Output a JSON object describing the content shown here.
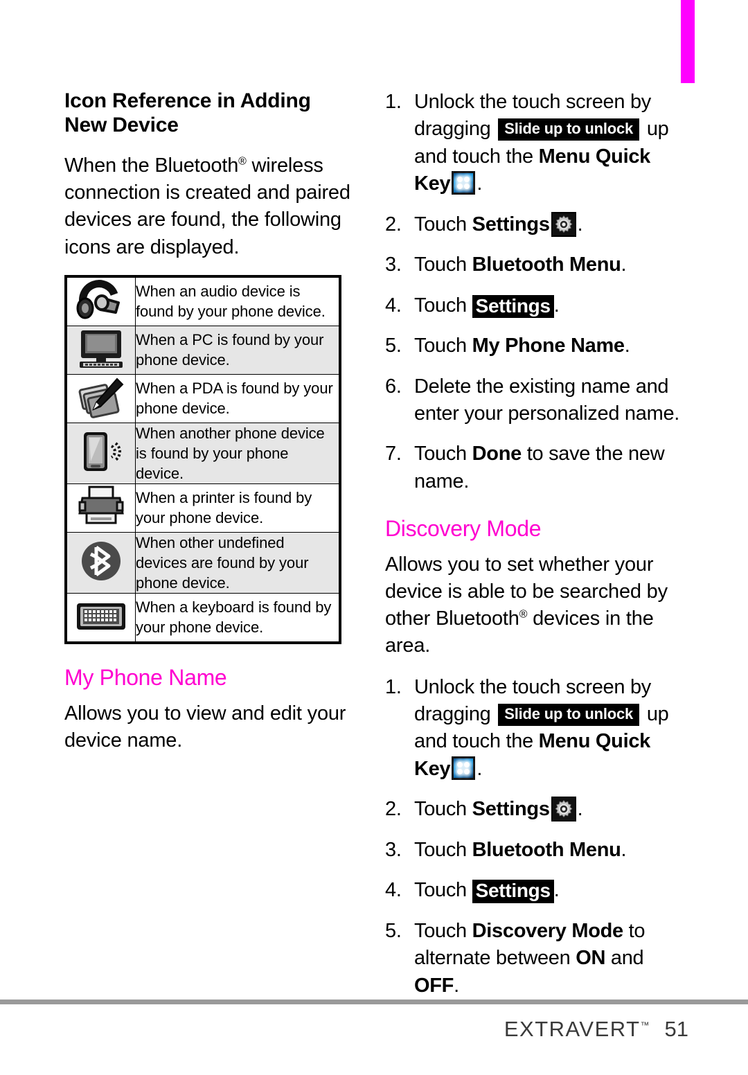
{
  "page": {
    "number": "51",
    "brand": "EXTRAVERT",
    "brand_tm": "™",
    "accent_color": "#ff00d0",
    "tab_color": "#ff00ff"
  },
  "left_column": {
    "heading": "Icon Reference in Adding New Device",
    "intro_before_reg": "When the Bluetooth",
    "intro_reg": "®",
    "intro_after_reg": " wireless connection is created and paired devices are found, the following icons are displayed.",
    "icon_table": {
      "rows": [
        {
          "icon": "audio-headset-icon",
          "shaded": false,
          "text": "When an audio device is found by your phone device."
        },
        {
          "icon": "pc-monitor-icon",
          "shaded": true,
          "text": "When a PC is found by your phone device."
        },
        {
          "icon": "pda-stylus-icon",
          "shaded": false,
          "text": "When a PDA is found by your phone device."
        },
        {
          "icon": "mobile-phone-icon",
          "shaded": true,
          "text": "When another phone device is found by your phone device."
        },
        {
          "icon": "printer-icon",
          "shaded": false,
          "text": "When a printer is found by your phone device."
        },
        {
          "icon": "bluetooth-icon",
          "shaded": true,
          "text": "When other undefined devices are found by your phone device."
        },
        {
          "icon": "keyboard-icon",
          "shaded": false,
          "text": "When a keyboard is found by your phone device."
        }
      ]
    },
    "my_phone_name": {
      "heading": "My Phone Name",
      "body": "Allows you to view and edit your device name."
    }
  },
  "right_column": {
    "my_phone_name_steps": [
      {
        "num": "1.",
        "parts": [
          {
            "t": "text",
            "v": "Unlock the touch screen by dragging "
          },
          {
            "t": "pill",
            "v": "Slide up to unlock"
          },
          {
            "t": "text",
            "v": " up and touch the "
          },
          {
            "t": "bold",
            "v": "Menu Quick Key"
          },
          {
            "t": "icon",
            "v": "menu-quick-key-icon"
          },
          {
            "t": "text",
            "v": "."
          }
        ]
      },
      {
        "num": "2.",
        "parts": [
          {
            "t": "text",
            "v": "Touch "
          },
          {
            "t": "bold",
            "v": "Settings"
          },
          {
            "t": "icon",
            "v": "settings-gear-icon"
          },
          {
            "t": "text",
            "v": "."
          }
        ]
      },
      {
        "num": "3.",
        "parts": [
          {
            "t": "text",
            "v": "Touch "
          },
          {
            "t": "bold",
            "v": "Bluetooth Menu"
          },
          {
            "t": "text",
            "v": "."
          }
        ]
      },
      {
        "num": "4.",
        "parts": [
          {
            "t": "text",
            "v": "Touch "
          },
          {
            "t": "invpill",
            "v": "Settings"
          },
          {
            "t": "text",
            "v": "."
          }
        ]
      },
      {
        "num": "5.",
        "parts": [
          {
            "t": "text",
            "v": "Touch "
          },
          {
            "t": "bold",
            "v": "My Phone Name"
          },
          {
            "t": "text",
            "v": "."
          }
        ]
      },
      {
        "num": "6.",
        "parts": [
          {
            "t": "text",
            "v": "Delete the existing name and enter your personalized name."
          }
        ]
      },
      {
        "num": "7.",
        "parts": [
          {
            "t": "text",
            "v": "Touch "
          },
          {
            "t": "bold",
            "v": "Done"
          },
          {
            "t": "text",
            "v": " to save the new name."
          }
        ]
      }
    ],
    "discovery_mode": {
      "heading": "Discovery Mode",
      "body_before_reg": "Allows you to set whether your device is able to be searched by other Bluetooth",
      "body_reg": "®",
      "body_after_reg": " devices in the area.",
      "steps": [
        {
          "num": "1.",
          "parts": [
            {
              "t": "text",
              "v": "Unlock the touch screen by dragging "
            },
            {
              "t": "pill",
              "v": "Slide up to unlock"
            },
            {
              "t": "text",
              "v": " up and touch the "
            },
            {
              "t": "bold",
              "v": "Menu Quick Key"
            },
            {
              "t": "icon",
              "v": "menu-quick-key-icon"
            },
            {
              "t": "text",
              "v": "."
            }
          ]
        },
        {
          "num": "2.",
          "parts": [
            {
              "t": "text",
              "v": "Touch "
            },
            {
              "t": "bold",
              "v": "Settings"
            },
            {
              "t": "icon",
              "v": "settings-gear-icon"
            },
            {
              "t": "text",
              "v": "."
            }
          ]
        },
        {
          "num": "3.",
          "parts": [
            {
              "t": "text",
              "v": "Touch "
            },
            {
              "t": "bold",
              "v": "Bluetooth Menu"
            },
            {
              "t": "text",
              "v": "."
            }
          ]
        },
        {
          "num": "4.",
          "parts": [
            {
              "t": "text",
              "v": "Touch "
            },
            {
              "t": "invpill",
              "v": "Settings"
            },
            {
              "t": "text",
              "v": "."
            }
          ]
        },
        {
          "num": "5.",
          "parts": [
            {
              "t": "text",
              "v": "Touch "
            },
            {
              "t": "bold",
              "v": "Discovery Mode"
            },
            {
              "t": "text",
              "v": " to alternate between "
            },
            {
              "t": "bold",
              "v": "ON"
            },
            {
              "t": "text",
              "v": " and "
            },
            {
              "t": "bold",
              "v": "OFF"
            },
            {
              "t": "text",
              "v": "."
            }
          ]
        }
      ]
    }
  }
}
